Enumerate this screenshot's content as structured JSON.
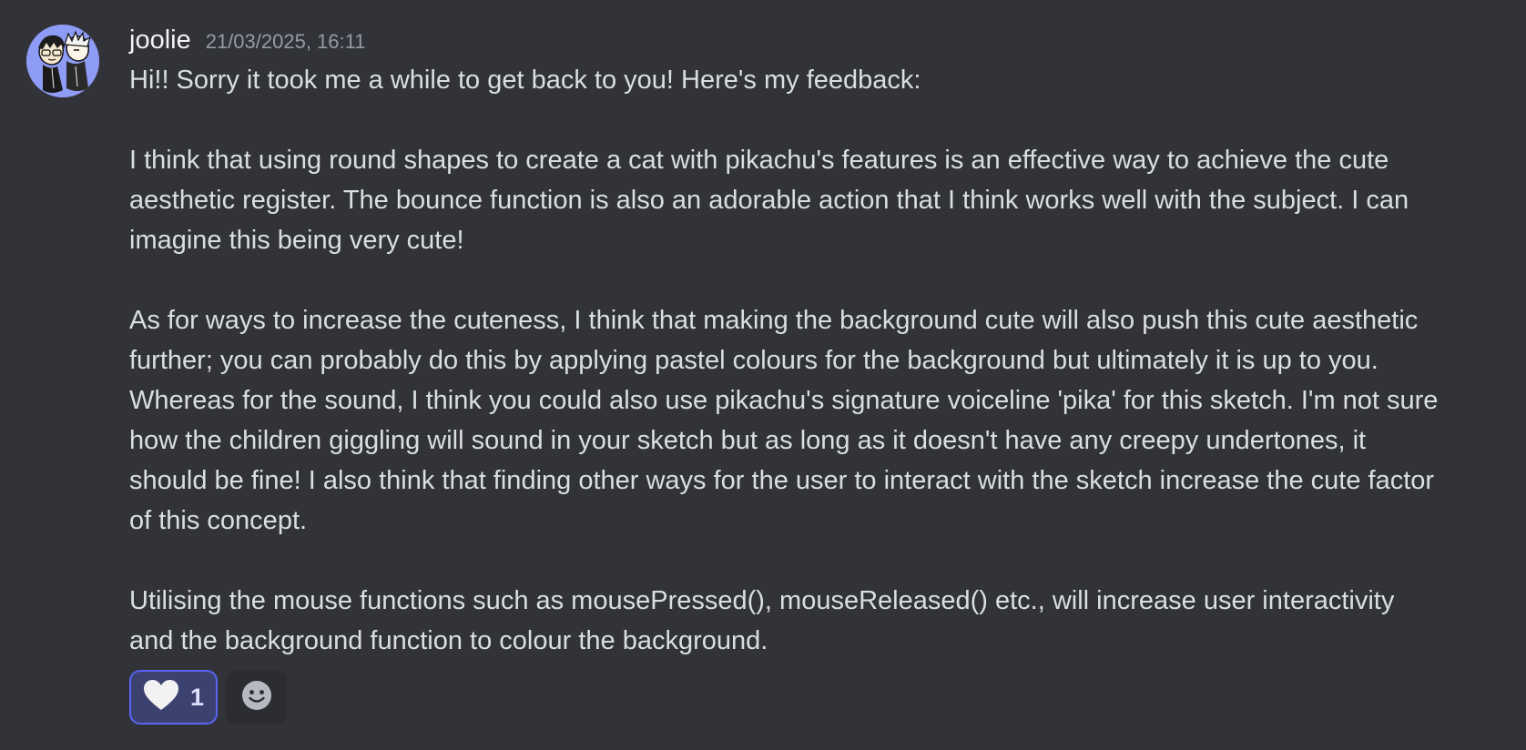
{
  "message": {
    "author": "joolie",
    "timestamp": "21/03/2025, 16:11",
    "paragraphs": [
      "Hi!! Sorry it took me a while to get back to you! Here's my feedback:",
      "I think that using round shapes to create a cat with pikachu's features is an effective way to achieve the cute aesthetic register. The bounce function is also an adorable action that I think works well with the subject. I can imagine this being very cute!",
      "As for ways to increase the cuteness, I think that making the background cute will also push this cute aesthetic further; you can probably do this by applying pastel colours for the background but ultimately it is up to you. Whereas for the sound, I think you could also use pikachu's signature voiceline 'pika' for this sketch. I'm not sure how the children giggling will sound in your sketch but as long as it doesn't have any creepy undertones, it should be fine! I also think that finding other ways for the user to interact with the sketch increase the cute factor of this concept.",
      "Utilising the mouse functions such as mousePressed(), mouseReleased() etc., will increase user interactivity and the background function to colour the background."
    ]
  },
  "reactions": [
    {
      "icon": "heart-icon",
      "count": "1",
      "active": true
    }
  ],
  "add_reaction": {
    "icon": "smiley-icon"
  },
  "colors": {
    "background": "#323339",
    "text": "#dbdee1",
    "username": "#f2f3f5",
    "timestamp": "#949ba4",
    "accent": "#5865f2",
    "avatar_bg": "#8e9cf6"
  }
}
